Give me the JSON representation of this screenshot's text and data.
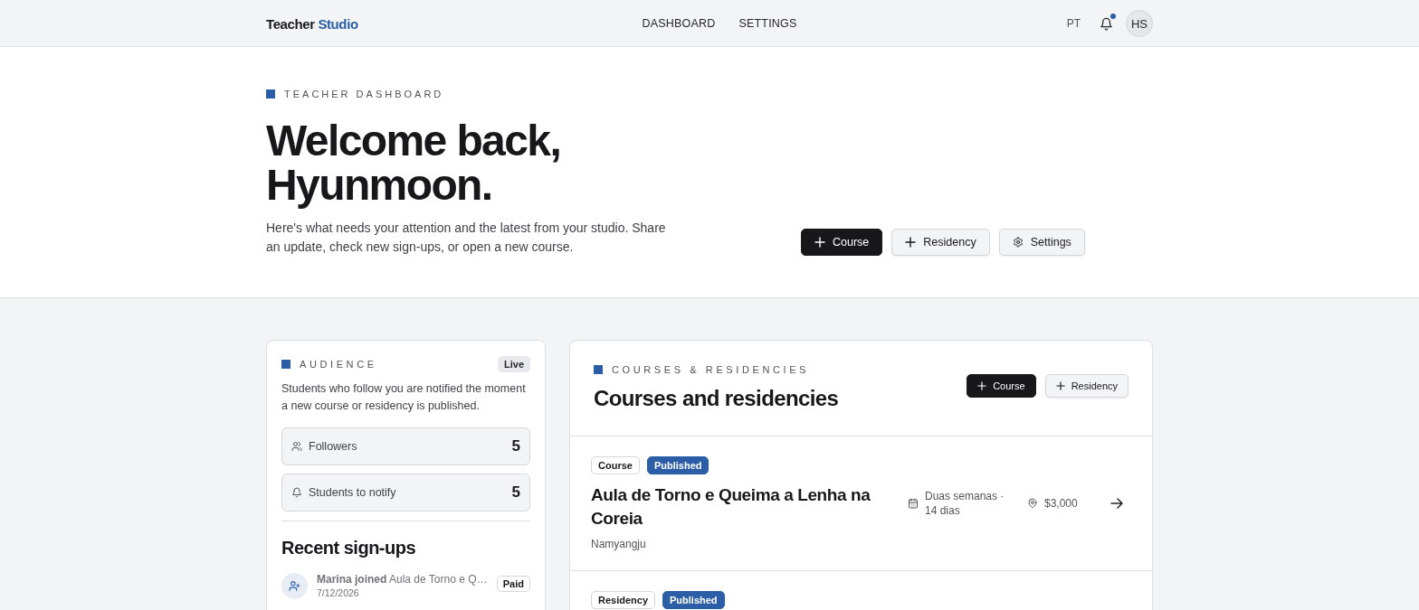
{
  "header": {
    "logo": {
      "first": "Teacher",
      "second": "Studio"
    },
    "nav": [
      {
        "label": "DASHBOARD"
      },
      {
        "label": "SETTINGS"
      }
    ],
    "language": "PT",
    "notifications": {
      "unread": true
    },
    "avatar": "HS"
  },
  "hero": {
    "eyebrow": "TEACHER DASHBOARD",
    "title": "Welcome back, Hyunmoon.",
    "description": "Here's what needs your attention and the latest from your studio. Share an update, check new sign-ups, or open a new course.",
    "buttons": [
      {
        "label": "Course",
        "kind": "primary"
      },
      {
        "label": "Residency",
        "kind": "secondary"
      },
      {
        "label": "Settings",
        "kind": "settings"
      }
    ]
  },
  "audience": {
    "eyebrow": "AUDIENCE",
    "badge": "Live",
    "description": "Students who follow you are notified the moment a new course or residency is published.",
    "stats": [
      {
        "label": "Followers",
        "value": "5",
        "kind": "followers"
      },
      {
        "label": "Students to notify",
        "value": "5",
        "kind": "notify"
      }
    ],
    "recent_heading": "Recent sign-ups",
    "signups": [
      {
        "text": "**Marina joined** Aula de Torno e Q…",
        "date": "7/12/2026",
        "badge": "Paid"
      }
    ]
  },
  "courses": {
    "eyebrow": "COURSES & RESIDENCIES",
    "title": "Courses and residencies",
    "buttons": [
      {
        "label": "Course",
        "kind": "primary"
      },
      {
        "label": "Residency",
        "kind": "secondary"
      }
    ],
    "items": [
      {
        "badges": [
          {
            "label": "Course",
            "kind": "outline"
          },
          {
            "label": "Published",
            "kind": "filled"
          }
        ],
        "title": "Aula de Torno e Queima a Lenha na Coreia",
        "location": "Namyangju",
        "meta": [
          {
            "kind": "date",
            "text": "Duas semanas · 14 dias"
          },
          {
            "kind": "place",
            "text": "$3,000"
          }
        ]
      },
      {
        "badges": [
          {
            "label": "Residency",
            "kind": "outline"
          },
          {
            "label": "Published",
            "kind": "filled"
          }
        ]
      }
    ]
  }
}
